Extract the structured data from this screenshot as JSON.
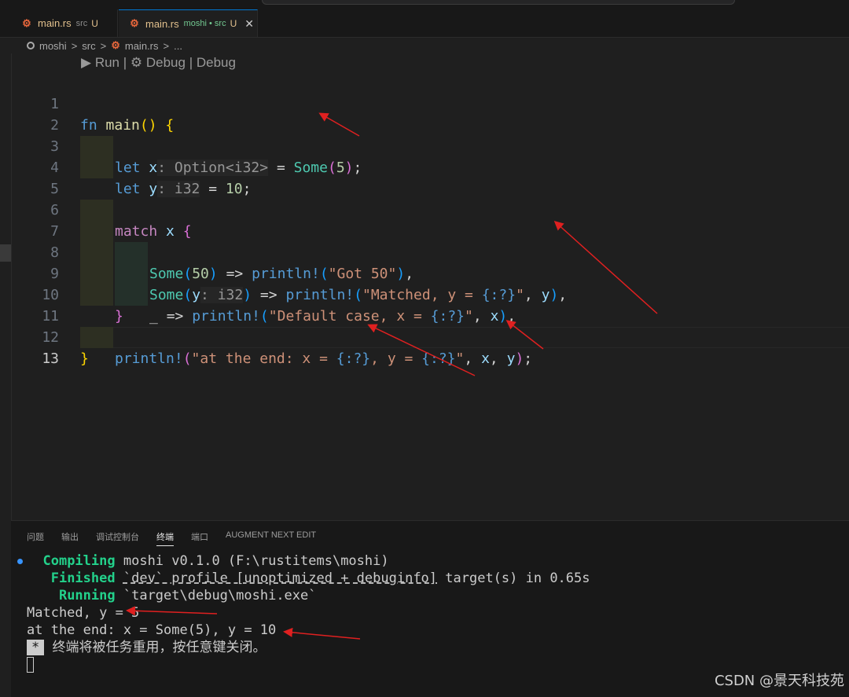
{
  "tabs": [
    {
      "icon": "rust-file-icon",
      "filename": "main.rs",
      "dir": "src",
      "status": "U"
    },
    {
      "icon": "rust-file-icon",
      "filename": "main.rs",
      "dir": "moshi • src",
      "status": "U",
      "close": "✕"
    }
  ],
  "breadcrumb": {
    "root": "moshi",
    "sep1": ">",
    "folder": "src",
    "sep2": ">",
    "file": "main.rs",
    "sep3": ">",
    "more": "..."
  },
  "codelens": {
    "run": "Run",
    "sep": "|",
    "debug1": "Debug",
    "debug2": "Debug"
  },
  "line_numbers": [
    "1",
    "2",
    "3",
    "4",
    "5",
    "6",
    "7",
    "8",
    "9",
    "10",
    "11",
    "12",
    "13"
  ],
  "code": {
    "l1": {
      "kw": "fn",
      "name": "main",
      "paren": "()",
      "brace": "{"
    },
    "l2": {
      "kw": "let",
      "var": "x",
      "hint": ": Option<i32>",
      "eq": "=",
      "ctor": "Some",
      "open": "(",
      "num": "5",
      "close": ")",
      "semi": ";"
    },
    "l3": {
      "kw": "let",
      "var": "y",
      "hint": ": i32",
      "eq": "=",
      "num": "10",
      "semi": ";"
    },
    "l5": {
      "kw": "match",
      "var": "x",
      "brace": "{"
    },
    "l6": {
      "ctor": "Some",
      "open": "(",
      "num": "50",
      "close": ")",
      "arrow": "=>",
      "mac": "println!",
      "p1": "(",
      "str": "\"Got 50\"",
      "p2": ")",
      "comma": ","
    },
    "l7": {
      "ctor": "Some",
      "open": "(",
      "var": "y",
      "hint": ": i32",
      "close": ")",
      "arrow": "=>",
      "mac": "println!",
      "p1": "(",
      "str1": "\"Matched, y = ",
      "fmt": "{:?}",
      "str2": "\"",
      "comma1": ",",
      "arg": "y",
      "p2": ")",
      "comma": ","
    },
    "l8": {
      "us": "_",
      "arrow": "=>",
      "mac": "println!",
      "p1": "(",
      "str1": "\"Default case, x = ",
      "fmt": "{:?}",
      "str2": "\"",
      "comma1": ",",
      "arg": "x",
      "p2": ")",
      "comma": ","
    },
    "l9": {
      "brace": "}"
    },
    "l11": {
      "mac": "println!",
      "p1": "(",
      "str1": "\"at the end: x = ",
      "fmt1": "{:?}",
      "str2": ", y = ",
      "fmt2": "{:?}",
      "str3": "\"",
      "c1": ",",
      "a1": "x",
      "c2": ",",
      "a2": "y",
      "p2": ")",
      "semi": ";"
    },
    "l12": {
      "brace": "}"
    }
  },
  "panel": {
    "tabs": [
      "问题",
      "输出",
      "调试控制台",
      "终端",
      "端口",
      "AUGMENT NEXT EDIT"
    ],
    "active_tab": "终端"
  },
  "terminal": {
    "compiling_label": "Compiling",
    "compiling_text": "moshi v0.1.0 (F:\\rustitems\\moshi)",
    "finished_label": "Finished",
    "finished_text1": "`dev` profile [unoptimized + debuginfo]",
    "finished_text2": " target(s) in 0.65s",
    "running_label": "Running",
    "running_text": "`target\\debug\\moshi.exe`",
    "out1": "Matched, y = 5",
    "out2": "at the end: x = Some(5), y = 10",
    "star": "*",
    "reuse_msg": "终端将被任务重用，按任意键关闭。"
  },
  "watermark": "CSDN @景天科技苑",
  "colors": {
    "annotation_arrow": "#e02020",
    "accent": "#0078d4"
  }
}
